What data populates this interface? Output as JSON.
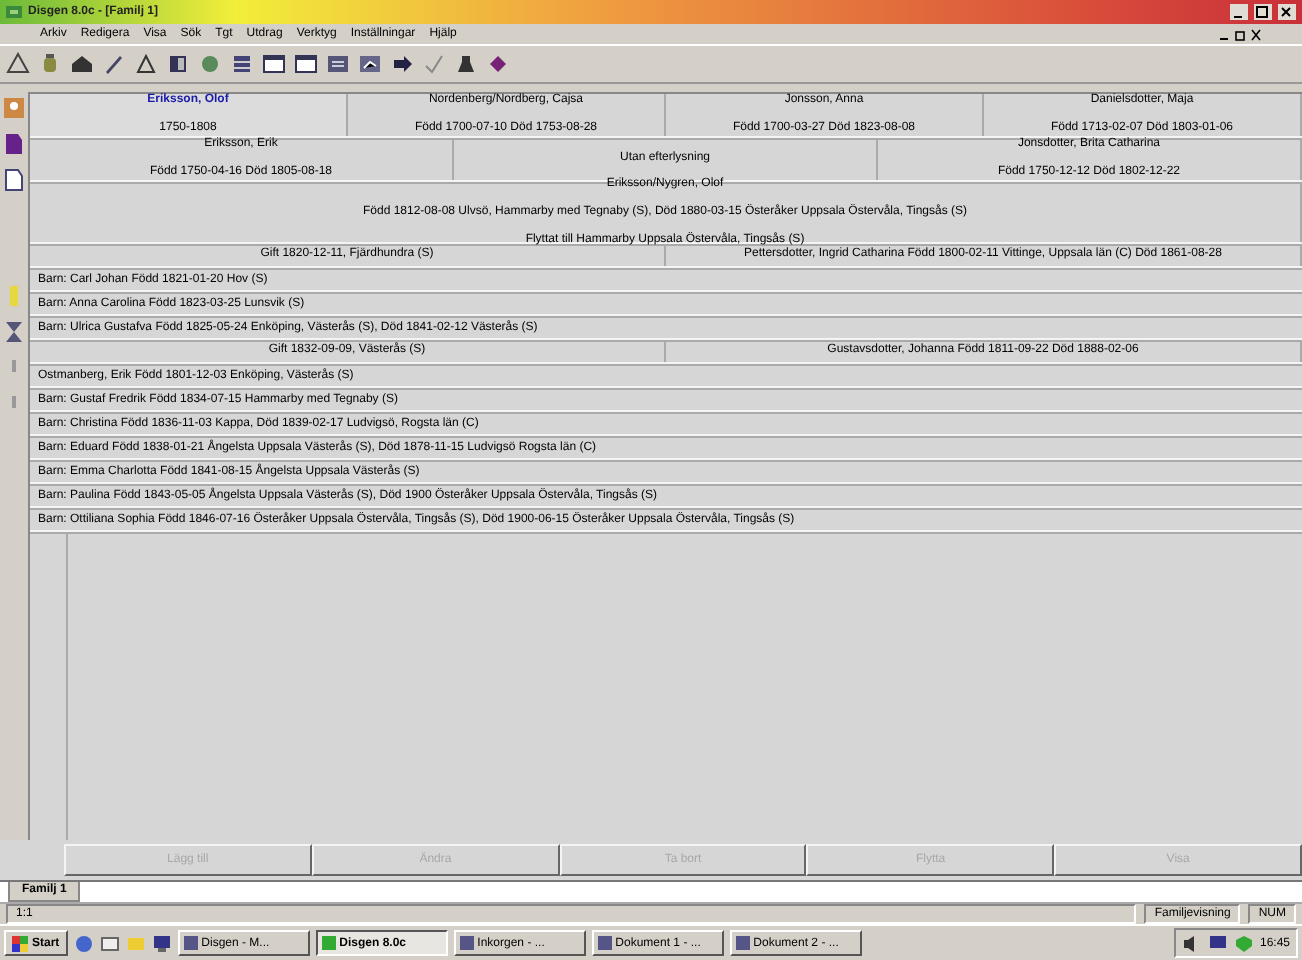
{
  "window": {
    "title": "Disgen 8.0c - [Familj 1]"
  },
  "menu": [
    "Arkiv",
    "Redigera",
    "Visa",
    "Sök",
    "Tgt",
    "Utdrag",
    "Verktyg",
    "Inställningar",
    "Hjälp"
  ],
  "grandparents": [
    {
      "name": "Eriksson, Olof",
      "dates": "1750-1808",
      "selected": true
    },
    {
      "name": "Nordenberg/Nordberg, Cajsa",
      "dates": "Född 1700-07-10 Död 1753-08-28",
      "selected": false
    },
    {
      "name": "Jonsson, Anna",
      "dates": "Född 1700-03-27 Död 1823-08-08",
      "selected": false
    },
    {
      "name": "Danielsdotter, Maja",
      "dates": "Född 1713-02-07 Död 1803-01-06",
      "selected": false
    }
  ],
  "parents": [
    {
      "name": "Eriksson, Erik",
      "dates": "Född 1750-04-16 Död 1805-08-18"
    },
    {
      "name": "Utan efterlysning"
    },
    {
      "name": "Jonsdotter, Brita Catharina",
      "dates": "Född 1750-12-12 Död 1802-12-22"
    }
  ],
  "person": {
    "name": "Eriksson/Nygren, Olof",
    "lines": [
      "Född 1812-08-08 Ulvsö, Hammarby med Tegnaby (S), Död 1880-03-15 Österåker Uppsala Östervåla, Tingsås (S)",
      "Flyttat till Hammarby Uppsala Östervåla, Tingsås (S)"
    ]
  },
  "rows": [
    {
      "kind": "pair",
      "texts": [
        "Gift 1820-12-11, Fjärdhundra (S)",
        "Pettersdotter, Ingrid Catharina Född 1800-02-11 Vittinge, Uppsala län (C) Död 1861-08-28"
      ]
    },
    {
      "kind": "line",
      "texts": [
        "Barn: Carl Johan Född 1821-01-20 Hov (S)"
      ]
    },
    {
      "kind": "line",
      "texts": [
        "Barn: Anna Carolina Född 1823-03-25 Lunsvik (S)"
      ]
    },
    {
      "kind": "line",
      "texts": [
        "Barn: Ulrica Gustafva Född 1825-05-24 Enköping, Västerås (S), Död 1841-02-12 Västerås (S)"
      ]
    },
    {
      "kind": "pair",
      "texts": [
        "Gift 1832-09-09, Västerås (S)",
        "Gustavsdotter, Johanna Född 1811-09-22 Död 1888-02-06"
      ]
    },
    {
      "kind": "line",
      "texts": [
        "Ostmanberg, Erik Född 1801-12-03 Enköping, Västerås (S)"
      ]
    },
    {
      "kind": "line",
      "texts": [
        "Barn: Gustaf Fredrik Född 1834-07-15 Hammarby med Tegnaby (S)"
      ]
    },
    {
      "kind": "line",
      "texts": [
        "Barn: Christina Född 1836-11-03 Kappa, Död 1839-02-17 Ludvigsö, Rogsta län (C)"
      ]
    },
    {
      "kind": "line",
      "texts": [
        "Barn: Eduard Född 1838-01-21 Ångelsta Uppsala Västerås (S), Död 1878-11-15 Ludvigsö Rogsta län (C)"
      ]
    },
    {
      "kind": "line",
      "texts": [
        "Barn: Emma Charlotta Född 1841-08-15 Ångelsta Uppsala Västerås (S)"
      ]
    },
    {
      "kind": "line",
      "texts": [
        "Barn: Paulina Född 1843-05-05 Ångelsta Uppsala Västerås (S), Död 1900 Österåker Uppsala Östervåla, Tingsås (S)"
      ]
    },
    {
      "kind": "line",
      "texts": [
        "Barn: Ottiliana Sophia Född 1846-07-16 Österåker Uppsala Östervåla, Tingsås (S), Död 1900-06-15 Österåker Uppsala Östervåla, Tingsås (S)"
      ]
    }
  ],
  "buttons": [
    {
      "label": "Lägg till",
      "disabled": true
    },
    {
      "label": "Ändra",
      "disabled": true
    },
    {
      "label": "Ta bort",
      "disabled": true
    },
    {
      "label": "Flytta",
      "disabled": true
    },
    {
      "label": "Visa",
      "disabled": true
    }
  ],
  "tabs": [
    {
      "label": "Familj 1",
      "selected": true
    }
  ],
  "status_bar": [
    "1:1",
    "Familjevisning",
    "NUM"
  ],
  "taskbar": {
    "start": "Start",
    "tasks": [
      {
        "label": "Disgen - M...",
        "selected": false
      },
      {
        "label": "Disgen 8.0c",
        "selected": true
      },
      {
        "label": "Inkorgen - ...",
        "selected": false
      },
      {
        "label": "Dokument 1 - ...",
        "selected": false
      },
      {
        "label": "Dokument 2 - ...",
        "selected": false
      }
    ],
    "clock": "16:45"
  }
}
